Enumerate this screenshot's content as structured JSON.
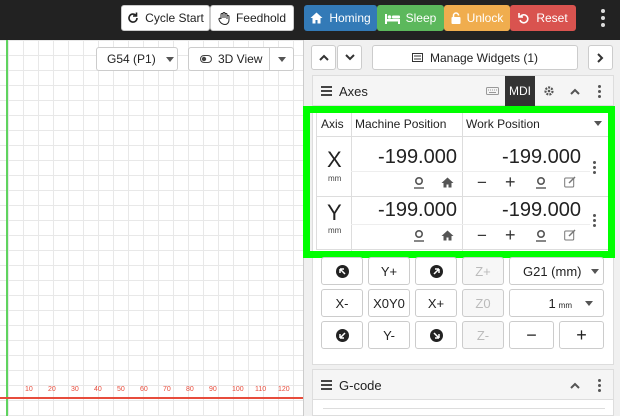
{
  "toolbar": {
    "cycle_start": "Cycle Start",
    "feedhold": "Feedhold",
    "homing": "Homing",
    "sleep": "Sleep",
    "unlock": "Unlock",
    "reset": "Reset"
  },
  "colors": {
    "homing": "#337ab7",
    "sleep": "#5cb85c",
    "unlock": "#f0ad4e",
    "reset": "#d9534f",
    "highlight": "#00ff00"
  },
  "visualizer": {
    "wcs": "G54 (P1)",
    "view": "3D View",
    "ticks": [
      "10",
      "20",
      "30",
      "40",
      "50",
      "60",
      "70",
      "80",
      "90",
      "100",
      "110",
      "120"
    ]
  },
  "widgets_bar": {
    "manage": "Manage Widgets (1)"
  },
  "axes": {
    "title": "Axes",
    "mdi": "MDI",
    "headers": {
      "axis": "Axis",
      "machine": "Machine Position",
      "work": "Work Position"
    },
    "rows": [
      {
        "axis": "X",
        "unit": "mm",
        "machine": "-199.000",
        "work": "-199.000"
      },
      {
        "axis": "Y",
        "unit": "mm",
        "machine": "-199.000",
        "work": "-199.000"
      }
    ]
  },
  "jog": {
    "y_plus": "Y+",
    "z_plus": "Z+",
    "units": "G21 (mm)",
    "x_minus": "X-",
    "x0y0": "X0Y0",
    "x_plus": "X+",
    "z0": "Z0",
    "step": "1",
    "step_unit": "mm",
    "y_minus": "Y-",
    "z_minus": "Z-",
    "minus": "−",
    "plus": "+"
  },
  "gcode": {
    "title": "G-code"
  }
}
